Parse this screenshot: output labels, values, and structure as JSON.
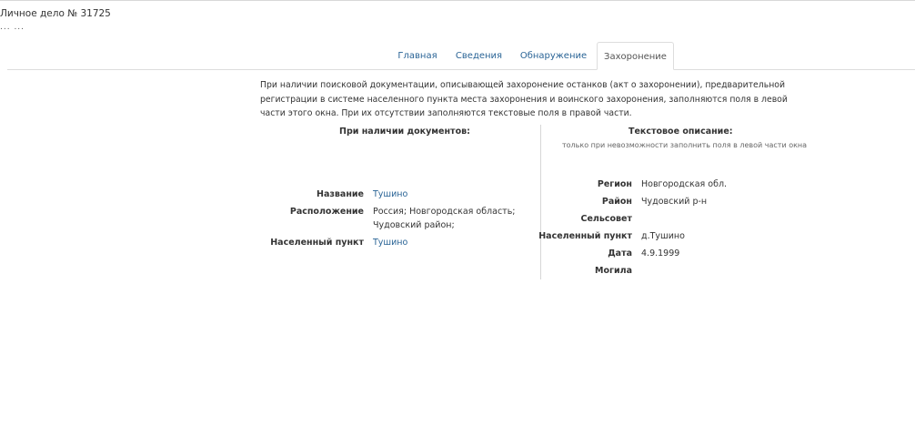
{
  "header": {
    "title": "Личное дело № 31725",
    "subtitle": "... ..."
  },
  "tabs": [
    {
      "label": "Главная",
      "active": false
    },
    {
      "label": "Сведения",
      "active": false
    },
    {
      "label": "Обнаружение",
      "active": false
    },
    {
      "label": "Захоронение",
      "active": true
    }
  ],
  "intro": "При наличии поисковой документации, описывающей захоронение останков (акт о захоронении), предварительной регистрации в системе населенного пункта места захоронения и воинского захоронения, заполняются поля в левой части этого окна. При их отсутствии заполняются текстовые поля в правой части.",
  "left": {
    "heading": "При наличии документов:",
    "fields": {
      "name_label": "Название",
      "name_value": "Тушино",
      "location_label": "Расположение",
      "location_value_1": "Россия; Новгородская область;",
      "location_value_2": "Чудовский район;",
      "settlement_label": "Населенный пункт",
      "settlement_value": "Тушино"
    }
  },
  "right": {
    "heading": "Текстовое описание:",
    "subheading": "только при невозможности заполнить поля в левой части окна",
    "fields": {
      "region_label": "Регион",
      "region_value": "Новгородская обл.",
      "district_label": "Район",
      "district_value": "Чудовский р-н",
      "council_label": "Сельсовет",
      "council_value": "",
      "settlement_label": "Населенный пункт",
      "settlement_value": "д.Тушино",
      "date_label": "Дата",
      "date_value": "4.9.1999",
      "grave_label": "Могила",
      "grave_value": ""
    }
  },
  "colors": {
    "link": "#2a6496",
    "text": "#333333",
    "border": "#dddddd"
  }
}
